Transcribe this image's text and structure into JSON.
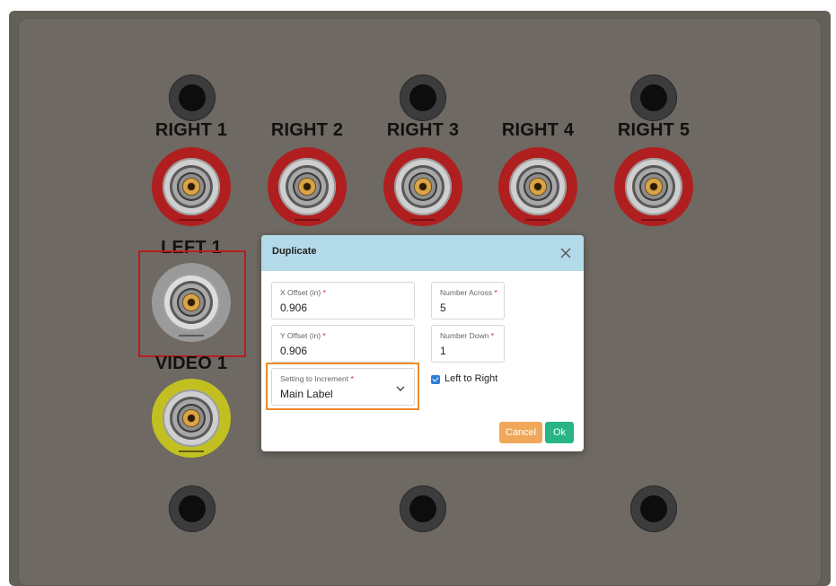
{
  "panel": {
    "top_labels": [
      "RIGHT 1",
      "RIGHT 2",
      "RIGHT 3",
      "RIGHT 4",
      "RIGHT 5"
    ],
    "left_label": "LEFT 1",
    "video_label": "VIDEO 1",
    "colors": {
      "red_jack": "#b01f1f",
      "yellow_jack": "#c2c021",
      "selection": "#b81d1d"
    }
  },
  "modal": {
    "title": "Duplicate",
    "x_offset": {
      "label": "X Offset (in)",
      "value": "0.906"
    },
    "y_offset": {
      "label": "Y Offset (in)",
      "value": "0.906"
    },
    "number_across": {
      "label": "Number Across",
      "value": "5"
    },
    "number_down": {
      "label": "Number Down",
      "value": "1"
    },
    "setting_to_increment": {
      "label": "Setting to Increment",
      "value": "Main Label"
    },
    "required_marker": "*",
    "left_to_right": {
      "label": "Left to Right",
      "checked": true
    },
    "cancel_label": "Cancel",
    "ok_label": "Ok",
    "icons": {
      "close": "close-icon",
      "dropdown": "chevron-down-icon"
    },
    "colors": {
      "header": "#b3dae8",
      "cancel": "#f0a75a",
      "ok": "#28b487",
      "highlight": "#ec8a2b"
    }
  }
}
